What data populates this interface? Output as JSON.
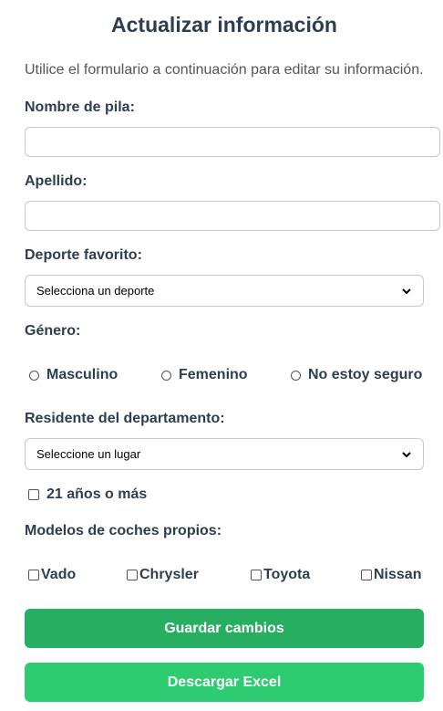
{
  "form": {
    "title": "Actualizar información",
    "intro": "Utilice el formulario a continuación para editar su información.",
    "first_name": {
      "label": "Nombre de pila:",
      "value": ""
    },
    "last_name": {
      "label": "Apellido:",
      "value": ""
    },
    "sport": {
      "label": "Deporte favorito:",
      "selected": "Selecciona un deporte"
    },
    "gender": {
      "label": "Género:",
      "options": [
        "Masculino",
        "Femenino",
        "No estoy seguro"
      ]
    },
    "residence": {
      "label": "Residente del departamento:",
      "selected": "Seleccione un lugar"
    },
    "age_check": {
      "label": "21 años o más",
      "checked": false
    },
    "cars": {
      "label": "Modelos de coches propios:",
      "options": [
        "Vado",
        "Chrysler",
        "Toyota",
        "Nissan"
      ]
    },
    "save_button": "Guardar cambios",
    "download_button": "Descargar Excel"
  },
  "colors": {
    "heading": "#2c3e50",
    "save_button": "#27ae60",
    "download_button": "#2ecc71"
  },
  "icons": {
    "select_arrow": "chevron-down-icon"
  }
}
